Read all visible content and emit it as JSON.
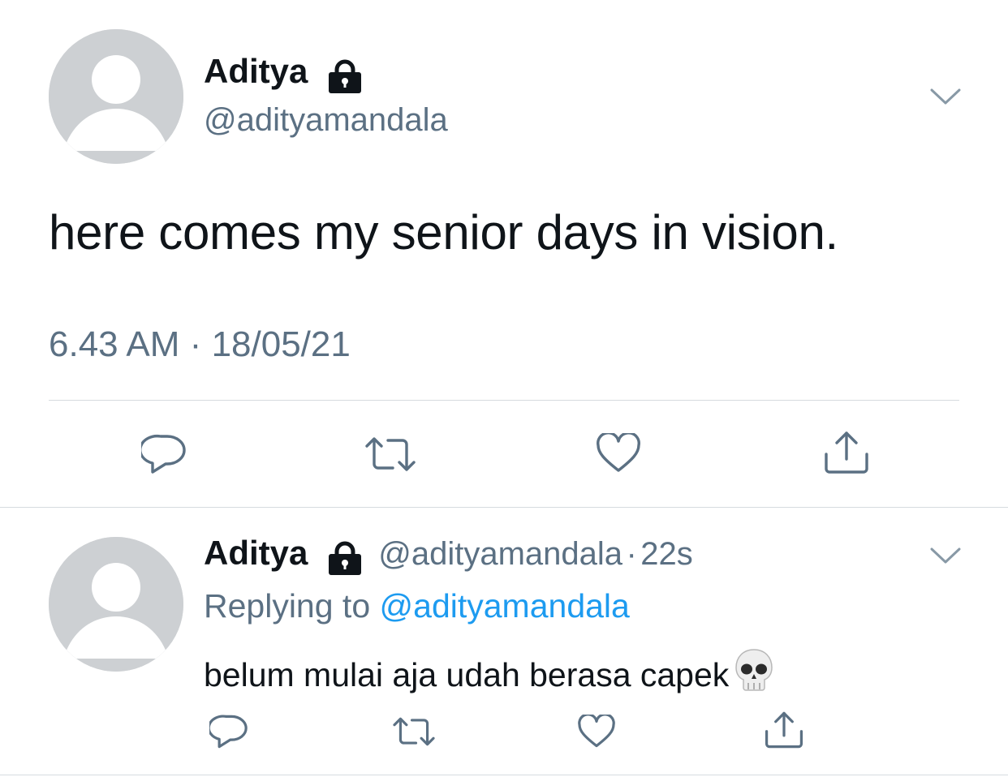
{
  "tweet": {
    "author_name": "Aditya",
    "author_handle": "@adityamandala",
    "text": "here comes my senior days in vision.",
    "time": "6.43 AM",
    "separator": "·",
    "date": "18/05/21"
  },
  "reply": {
    "author_name": "Aditya",
    "author_handle": "@adityamandala",
    "separator": "·",
    "age": "22s",
    "replying_prefix": "Replying to",
    "replying_to": "@adityamandala",
    "text": "belum mulai aja udah berasa capek"
  },
  "icons": {
    "lock": "lock-icon",
    "chevron": "chevron-down-icon",
    "reply": "reply-icon",
    "retweet": "retweet-icon",
    "like": "heart-icon",
    "share": "share-icon",
    "emoji": "skull-emoji"
  },
  "colors": {
    "name": "#0f1419",
    "secondary": "#5b7083",
    "link": "#1d9bf0",
    "icon": "#5b7083",
    "divider": "#d6dbdf",
    "avatar": "#cdd0d3"
  }
}
